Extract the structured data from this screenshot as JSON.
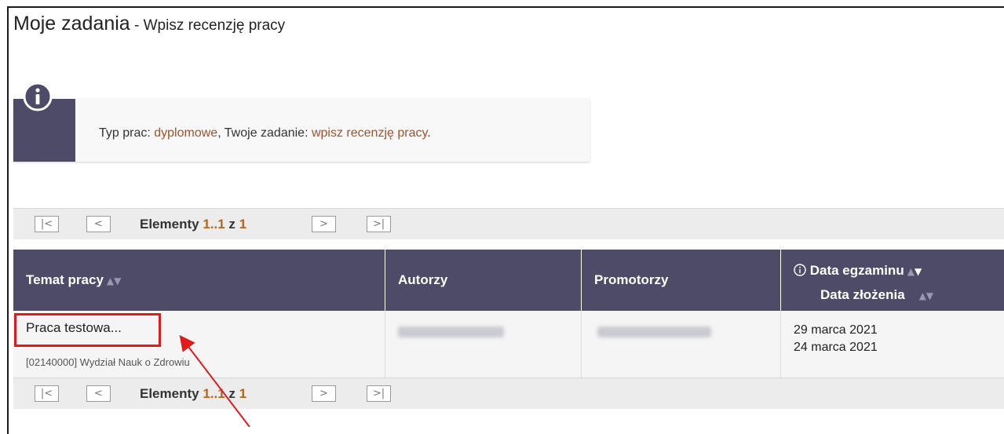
{
  "page": {
    "title_main": "Moje zadania",
    "title_sub": " - Wpisz recenzję pracy"
  },
  "info": {
    "prefix": "Typ prac: ",
    "type": "dyplomowe",
    "middle": ", Twoje zadanie: ",
    "task": "wpisz recenzję pracy",
    "suffix": "."
  },
  "pager": {
    "first_icon": "first-page-icon",
    "prev_icon": "prev-page-icon",
    "next_icon": "next-page-icon",
    "last_icon": "last-page-icon",
    "label": "Elementy ",
    "range": "1..1",
    "of": " z ",
    "total": "1"
  },
  "table": {
    "columns": [
      {
        "label": "Temat pracy"
      },
      {
        "label": "Autorzy"
      },
      {
        "label": "Promotorzy"
      },
      {
        "label_line1": "Data egzaminu",
        "label_line2": "Data złożenia"
      }
    ],
    "rows": [
      {
        "topic": "Praca testowa...",
        "unit": "[02140000] Wydział Nauk o Zdrowiu",
        "exam_date": "29 marca 2021",
        "submit_date": "24 marca 2021"
      }
    ]
  },
  "colors": {
    "header": "#4d4b67",
    "accent": "#a0522d",
    "highlight": "#e11b1b"
  }
}
